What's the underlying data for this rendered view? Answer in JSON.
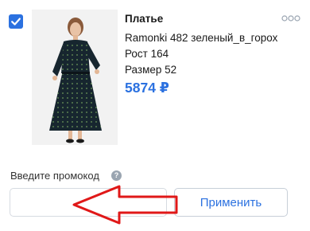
{
  "colors": {
    "accent": "#2b71e0",
    "price": "#2b71e0",
    "annotation": "#e01818",
    "muted": "#9aa5b1",
    "dress": "#17262f"
  },
  "item": {
    "checked": true,
    "checkbox_icon": "check-icon",
    "title": "Платье",
    "attributes": [
      "Ramonki 482 зеленый_в_горох",
      "Рост 164",
      "Размер 52"
    ],
    "price": "5874 ₽",
    "more_icon": "more-dots-icon"
  },
  "promo": {
    "label": "Введите промокод",
    "help_icon_text": "?",
    "input_value": "",
    "apply_label": "Применить"
  }
}
